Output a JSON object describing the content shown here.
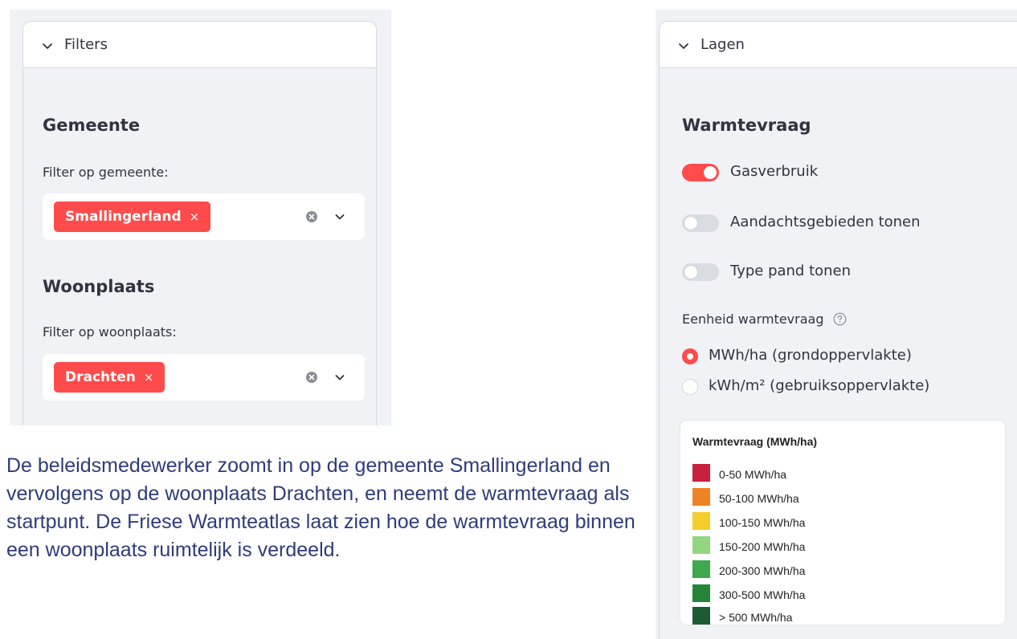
{
  "filters": {
    "header_label": "Filters",
    "gemeente": {
      "title": "Gemeente",
      "label": "Filter op gemeente:",
      "selected_tag": "Smallingerland",
      "tag_remove": "×"
    },
    "woonplaats": {
      "title": "Woonplaats",
      "label": "Filter op woonplaats:",
      "selected_tag": "Drachten",
      "tag_remove": "×"
    }
  },
  "description": "De beleidsmedewerker zoomt in op de gemeente Smallingerland en vervolgens op de woonplaats Drachten, en neemt de warmtevraag als startpunt. De Friese Warmteatlas laat zien hoe de warmtevraag binnen een woonplaats ruimtelijk is verdeeld.",
  "lagen": {
    "header_label": "Lagen",
    "section_title": "Warmtevraag",
    "toggles": [
      {
        "label": "Gasverbruik",
        "on": true
      },
      {
        "label": "Aandachtsgebieden tonen",
        "on": false
      },
      {
        "label": "Type pand tonen",
        "on": false
      }
    ],
    "unit_label": "Eenheid warmtevraag",
    "unit_options": [
      {
        "label": "MWh/ha (grondoppervlakte)",
        "checked": true
      },
      {
        "label": "kWh/m² (gebruiksoppervlakte)",
        "checked": false
      }
    ],
    "legend": {
      "title": "Warmtevraag (MWh/ha)",
      "items": [
        {
          "label": "0-50 MWh/ha",
          "color": "#c8203f"
        },
        {
          "label": "50-100 MWh/ha",
          "color": "#ee8326"
        },
        {
          "label": "100-150 MWh/ha",
          "color": "#f5cd2c"
        },
        {
          "label": "150-200 MWh/ha",
          "color": "#92d680"
        },
        {
          "label": "200-300 MWh/ha",
          "color": "#3da84c"
        },
        {
          "label": "300-500 MWh/ha",
          "color": "#248539"
        },
        {
          "label": "> 500 MWh/ha",
          "color": "#1d5c33"
        }
      ]
    }
  },
  "icons": {
    "expander": "chevron-down-icon",
    "clear": "clear-circle-icon",
    "dropdown": "chevron-down-icon",
    "help": "question-circle-icon"
  },
  "colors": {
    "accent": "#ff4b4b",
    "panel_bg": "#f0f2f6",
    "text": "#31333f",
    "paragraph_text": "#2f3c78"
  }
}
